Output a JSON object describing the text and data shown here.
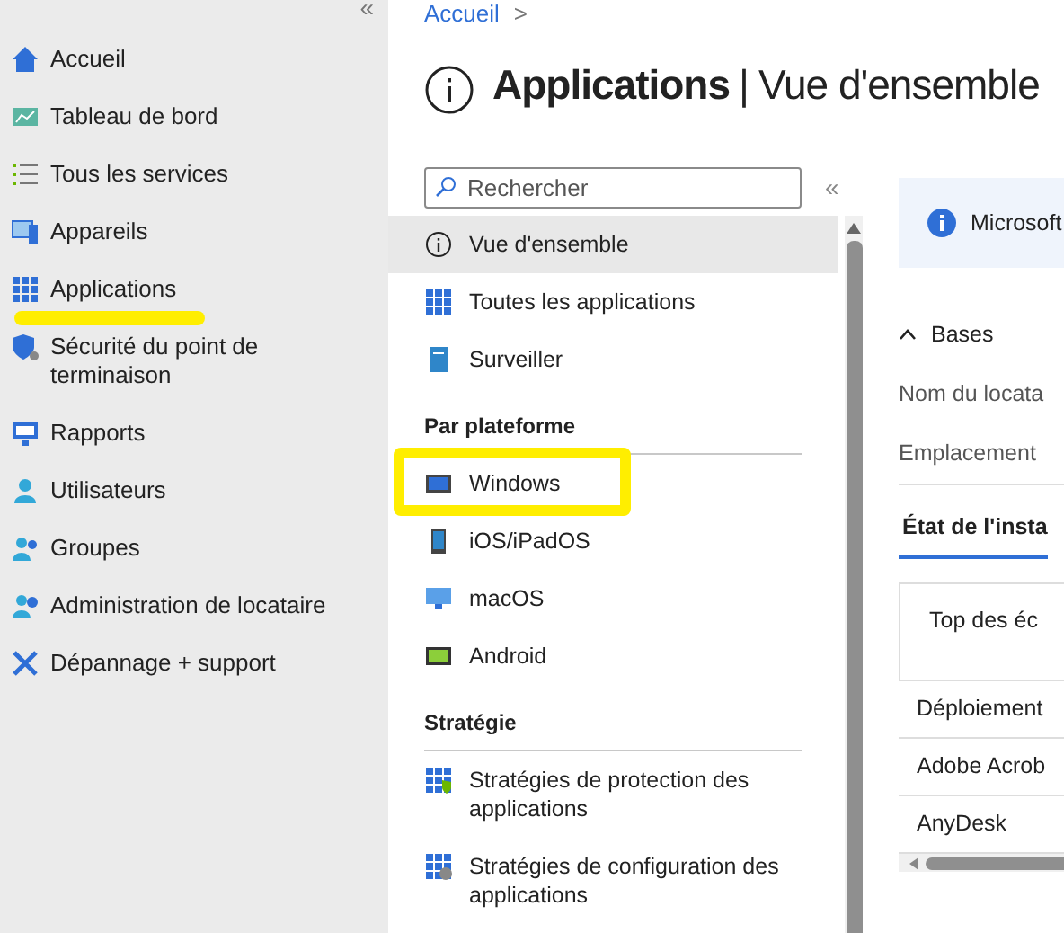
{
  "sidebar": {
    "collapse": "«",
    "items": [
      {
        "label": "Accueil",
        "selected": false,
        "marked": false
      },
      {
        "label": "Tableau de bord",
        "selected": false,
        "marked": false
      },
      {
        "label": "Tous les services",
        "selected": false,
        "marked": false
      },
      {
        "label": "Appareils",
        "selected": false,
        "marked": false
      },
      {
        "label": "Applications",
        "selected": false,
        "marked": true
      },
      {
        "label": "Sécurité du point de terminaison",
        "selected": false,
        "marked": false
      },
      {
        "label": "Rapports",
        "selected": false,
        "marked": false
      },
      {
        "label": "Utilisateurs",
        "selected": false,
        "marked": false
      },
      {
        "label": "Groupes",
        "selected": false,
        "marked": false
      },
      {
        "label": "Administration de locataire",
        "selected": false,
        "marked": false
      },
      {
        "label": "Dépannage + support",
        "selected": false,
        "marked": false
      }
    ]
  },
  "breadcrumb": {
    "items": [
      "Accueil"
    ],
    "separator": ">"
  },
  "page": {
    "title": "Applications",
    "separator": "|",
    "subtitle": "Vue d'ensemble"
  },
  "menu": {
    "search": {
      "placeholder": "Rechercher"
    },
    "collapse": "«",
    "sections": [
      {
        "items": [
          {
            "label": "Vue d'ensemble",
            "selected": true,
            "marked": false
          },
          {
            "label": "Toutes les applications",
            "selected": false,
            "marked": false
          },
          {
            "label": "Surveiller",
            "selected": false,
            "marked": false
          }
        ]
      },
      {
        "heading": "Par plateforme",
        "items": [
          {
            "label": "Windows",
            "selected": false,
            "marked": true
          },
          {
            "label": "iOS/iPadOS",
            "selected": false,
            "marked": false
          },
          {
            "label": "macOS",
            "selected": false,
            "marked": false
          },
          {
            "label": "Android",
            "selected": false,
            "marked": false
          }
        ]
      },
      {
        "heading": "Stratégie",
        "items": [
          {
            "label": "Stratégies de protection des applications",
            "selected": false,
            "marked": false
          },
          {
            "label": "Stratégies de configuration des applications",
            "selected": false,
            "marked": false
          }
        ]
      }
    ]
  },
  "content": {
    "banner": "Microsoft",
    "section": {
      "title": "Bases",
      "expanded": true
    },
    "fields": [
      "Nom du locata",
      "Emplacement"
    ],
    "tab": {
      "label": "État de l'insta",
      "selected": true
    },
    "card": "Top des éc",
    "rows": [
      "Déploiement",
      "Adobe Acrob",
      "AnyDesk"
    ]
  }
}
